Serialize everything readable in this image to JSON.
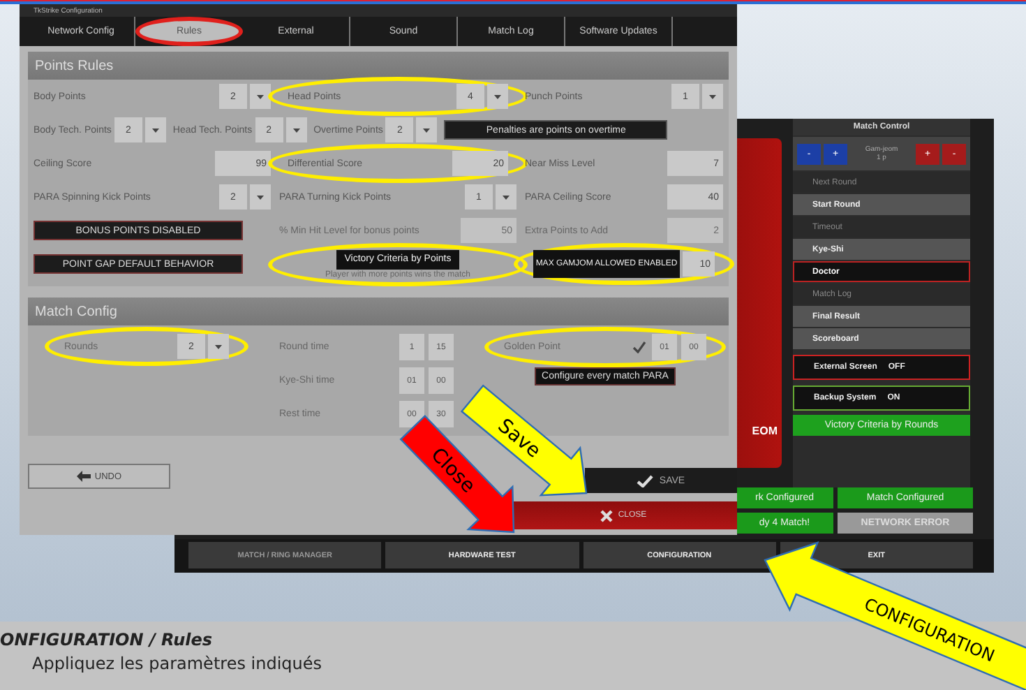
{
  "config_window": {
    "title": "TkStrike Configuration",
    "tabs": [
      {
        "label": "Network Config",
        "selected": false,
        "highlighted": false
      },
      {
        "label": "Rules",
        "selected": true,
        "highlighted": true
      },
      {
        "label": "External",
        "selected": false,
        "highlighted": false
      },
      {
        "label": "Sound",
        "selected": false,
        "highlighted": false
      },
      {
        "label": "Match Log",
        "selected": false,
        "highlighted": false
      },
      {
        "label": "Software Updates",
        "selected": false,
        "highlighted": false
      }
    ],
    "points_rules": {
      "title": "Points Rules",
      "rows": [
        {
          "items": [
            {
              "kind": "dropdown",
              "label": "Body Points",
              "value": "2",
              "highlighted": false
            },
            {
              "kind": "dropdown",
              "label": "Head Points",
              "value": "4",
              "highlighted": true
            },
            {
              "kind": "dropdown",
              "label": "Punch Points",
              "value": "1",
              "highlighted": false
            }
          ]
        },
        {
          "items": [
            {
              "kind": "dropdown",
              "label": "Body Tech. Points",
              "value": "2",
              "highlighted": false
            },
            {
              "kind": "dropdown",
              "label": "Head Tech. Points",
              "value": "2",
              "highlighted": false
            },
            {
              "kind": "dropdown",
              "label": "Overtime Points",
              "value": "2",
              "highlighted": false
            },
            {
              "kind": "button",
              "label": "Penalties are points on overtime",
              "highlighted": false
            }
          ]
        },
        {
          "items": [
            {
              "kind": "number",
              "label": "Ceiling Score",
              "value": "99",
              "disabled": false,
              "highlighted": false
            },
            {
              "kind": "number",
              "label": "Differential Score",
              "value": "20",
              "disabled": false,
              "highlighted": true
            },
            {
              "kind": "number",
              "label": "Near Miss Level",
              "value": "7",
              "disabled": false,
              "highlighted": false
            }
          ]
        },
        {
          "items": [
            {
              "kind": "dropdown",
              "label": "PARA Spinning Kick Points",
              "value": "2",
              "highlighted": false
            },
            {
              "kind": "dropdown",
              "label": "PARA Turning Kick Points",
              "value": "1",
              "highlighted": false
            },
            {
              "kind": "number",
              "label": "PARA Ceiling Score",
              "value": "40",
              "disabled": false,
              "highlighted": false
            }
          ]
        },
        {
          "items": [
            {
              "kind": "button",
              "label": "BONUS POINTS DISABLED",
              "highlighted": false
            },
            {
              "kind": "number",
              "label": "% Min Hit Level for bonus points",
              "value": "50",
              "disabled": true,
              "highlighted": false
            },
            {
              "kind": "number",
              "label": "Extra Points to Add",
              "value": "2",
              "disabled": true,
              "highlighted": false
            }
          ]
        },
        {
          "items": [
            {
              "kind": "button",
              "label": "POINT GAP DEFAULT BEHAVIOR",
              "highlighted": false
            },
            {
              "kind": "criteria",
              "label": "Victory Criteria by Points",
              "caption": "Player with more points wins the match",
              "highlighted": true
            },
            {
              "kind": "button_number",
              "label": "MAX GAMJOM ALLOWED ENABLED",
              "value": "10",
              "highlighted": true
            }
          ]
        }
      ]
    },
    "match_config": {
      "title": "Match Config",
      "rounds": {
        "label": "Rounds",
        "value": "2",
        "highlighted": true
      },
      "times": [
        {
          "label": "Round time",
          "values": [
            "1",
            "15"
          ]
        },
        {
          "label": "Kye-Shi time",
          "values": [
            "01",
            "00"
          ]
        },
        {
          "label": "Rest time",
          "values": [
            "00",
            "30"
          ]
        }
      ],
      "golden_point": {
        "label": "Golden Point",
        "checked": true,
        "values": [
          "01",
          "00"
        ],
        "highlighted": true
      },
      "para_button": "Configure every match PARA"
    },
    "undo": "UNDO",
    "save": "SAVE",
    "close": "CLOSE"
  },
  "match_window": {
    "score_text": "EOM",
    "panel_title": "Match Control",
    "gamjeom": {
      "left": [
        "-",
        "+"
      ],
      "label": "Gam-jeom",
      "sub": "1 p",
      "right": [
        "+",
        "-"
      ]
    },
    "menu": [
      {
        "label": "Next Round",
        "kind": "dim"
      },
      {
        "label": "Start Round",
        "kind": "action"
      },
      {
        "label": "Timeout",
        "kind": "dim"
      },
      {
        "label": "Kye-Shi",
        "kind": "action"
      },
      {
        "label": "Doctor",
        "kind": "alert"
      },
      {
        "label": "Match Log",
        "kind": "dim"
      },
      {
        "label": "Final Result",
        "kind": "action"
      },
      {
        "label": "Scoreboard",
        "kind": "action"
      }
    ],
    "toggles": [
      {
        "label": "External Screen",
        "value": "OFF",
        "on": false
      },
      {
        "label": "Backup System",
        "value": "ON",
        "on": true
      }
    ],
    "victory": "Victory Criteria by Rounds",
    "status": [
      {
        "label": "rk Configured",
        "ok": true
      },
      {
        "label": "Match Configured",
        "ok": true
      },
      {
        "label": "dy 4 Match!",
        "ok": true
      },
      {
        "label": "NETWORK ERROR",
        "ok": false
      }
    ],
    "nav": [
      {
        "label": "MATCH / RING MANAGER",
        "disabled": true
      },
      {
        "label": "HARDWARE TEST",
        "disabled": false
      },
      {
        "label": "CONFIGURATION",
        "disabled": false
      },
      {
        "label": "EXIT",
        "disabled": false
      }
    ]
  },
  "annotations": [
    {
      "kind": "save",
      "label": "Save"
    },
    {
      "kind": "close",
      "label": "Close"
    },
    {
      "kind": "config",
      "label": "CONFIGURATION"
    }
  ],
  "caption": {
    "title": "ONFIGURATION / Rules",
    "body": "Appliquez les paramètres indiqués"
  }
}
